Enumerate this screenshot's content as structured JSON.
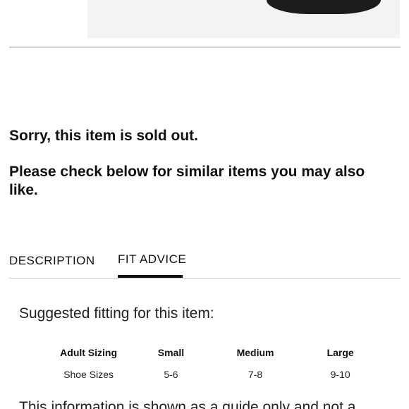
{
  "product": {
    "image_name": "product-image"
  },
  "messages": {
    "sold_out": "Sorry, this item is sold out.",
    "similar": "Please check below for similar items you may also like."
  },
  "tabs": [
    {
      "label": "DESCRIPTION",
      "active": false
    },
    {
      "label": "FIT ADVICE",
      "active": true
    }
  ],
  "fit": {
    "heading": "Suggested fitting for this item:",
    "headers": [
      "Adult Sizing",
      "Small",
      "Medium",
      "Large"
    ],
    "rows": [
      [
        "Shoe Sizes",
        "5-6",
        "7-8",
        "9-10"
      ]
    ],
    "disclaimer": "This information is shown as a guide only and not a"
  }
}
